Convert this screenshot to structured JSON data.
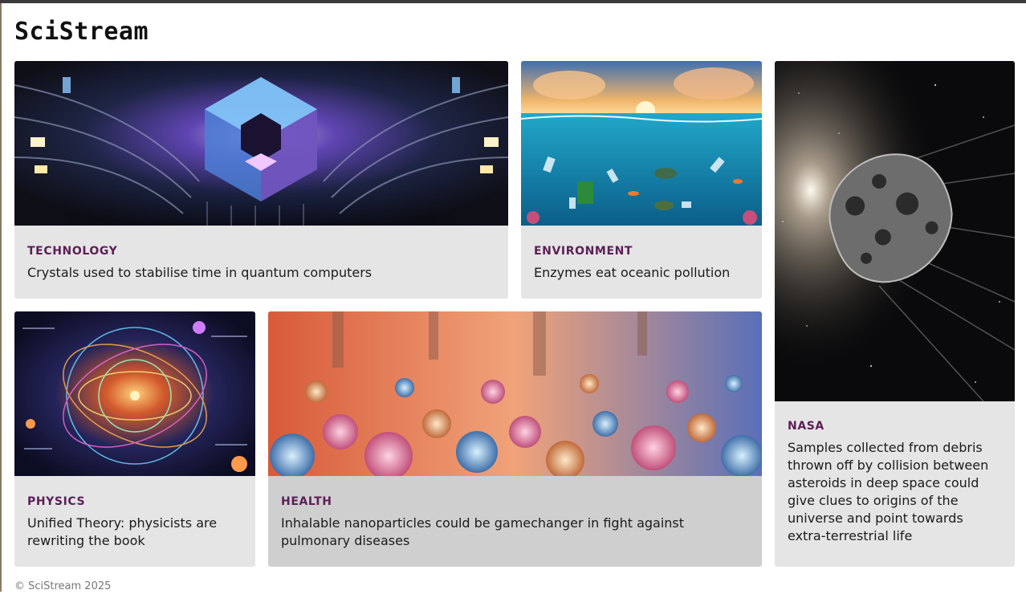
{
  "site": {
    "name": "SciStream"
  },
  "articles": [
    {
      "category": "TECHNOLOGY",
      "title": "Crystals used to stabilise time in quantum computers"
    },
    {
      "category": "ENVIRONMENT",
      "title": "Enzymes eat oceanic pollution"
    },
    {
      "category": "NASA",
      "title": "Samples collected from debris thrown off by collision between asteroids in deep space could give clues to origins of the universe and point towards extra-terrestrial life"
    },
    {
      "category": "PHYSICS",
      "title": "Unified Theory: physicists are rewriting the book"
    },
    {
      "category": "HEALTH",
      "title": "Inhalable nanoparticles could be gamechanger in fight against pulmonary diseases"
    }
  ],
  "footer": {
    "copyright": "© SciStream 2025"
  }
}
